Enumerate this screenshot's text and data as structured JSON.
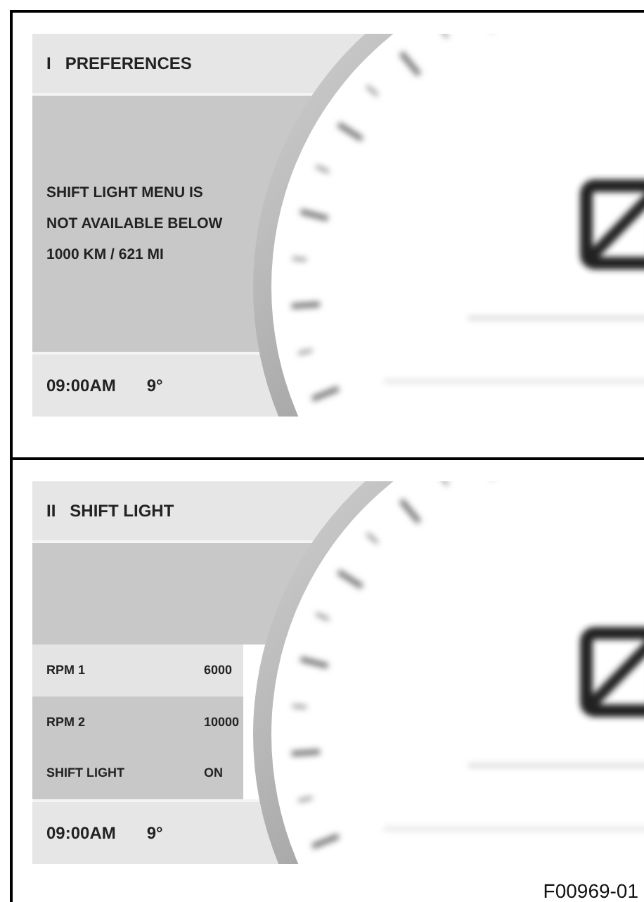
{
  "panels": [
    {
      "number": "I",
      "title": "PREFERENCES",
      "message": [
        "SHIFT LIGHT MENU IS",
        "NOT AVAILABLE BELOW",
        "1000 KM / 621 MI"
      ],
      "time": "09:00AM",
      "temperature": "9°"
    },
    {
      "number": "II",
      "title": "SHIFT LIGHT",
      "rows": [
        {
          "label": "RPM 1",
          "value": "6000",
          "selected": true
        },
        {
          "label": "RPM 2",
          "value": "10000",
          "selected": false
        },
        {
          "label": "SHIFT LIGHT",
          "value": "ON",
          "selected": false
        }
      ],
      "time": "09:00AM",
      "temperature": "9°"
    }
  ],
  "figure_id": "F00969-01"
}
